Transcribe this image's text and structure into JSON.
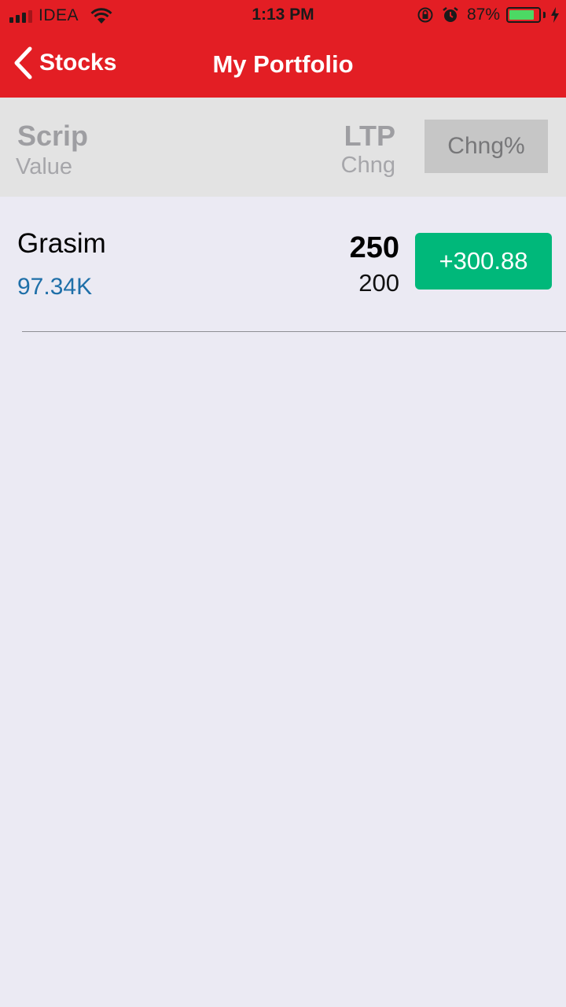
{
  "status": {
    "carrier": "IDEA",
    "time": "1:13 PM",
    "battery_pct": "87%",
    "battery_level": 0.87
  },
  "nav": {
    "back_label": "Stocks",
    "title": "My Portfolio"
  },
  "columns": {
    "scrip": "Scrip",
    "value": "Value",
    "ltp": "LTP",
    "chng": "Chng",
    "chng_pct": "Chng%"
  },
  "holdings": [
    {
      "name": "Grasim",
      "value": "97.34K",
      "ltp": "250",
      "chng": "200",
      "chng_pct": "+300.88"
    }
  ],
  "colors": {
    "brand_red": "#e31e24",
    "positive_green": "#00b87a",
    "value_blue": "#1e6fa8"
  }
}
